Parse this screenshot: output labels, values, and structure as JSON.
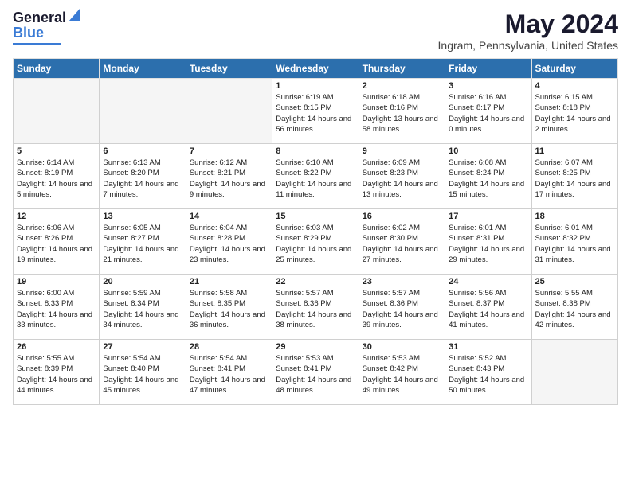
{
  "header": {
    "logo_text1": "General",
    "logo_text2": "Blue",
    "main_title": "May 2024",
    "subtitle": "Ingram, Pennsylvania, United States"
  },
  "weekdays": [
    "Sunday",
    "Monday",
    "Tuesday",
    "Wednesday",
    "Thursday",
    "Friday",
    "Saturday"
  ],
  "weeks": [
    [
      {
        "day": "",
        "sunrise": "",
        "sunset": "",
        "daylight": ""
      },
      {
        "day": "",
        "sunrise": "",
        "sunset": "",
        "daylight": ""
      },
      {
        "day": "",
        "sunrise": "",
        "sunset": "",
        "daylight": ""
      },
      {
        "day": "1",
        "sunrise": "Sunrise: 6:19 AM",
        "sunset": "Sunset: 8:15 PM",
        "daylight": "Daylight: 14 hours and 56 minutes."
      },
      {
        "day": "2",
        "sunrise": "Sunrise: 6:18 AM",
        "sunset": "Sunset: 8:16 PM",
        "daylight": "Daylight: 13 hours and 58 minutes."
      },
      {
        "day": "3",
        "sunrise": "Sunrise: 6:16 AM",
        "sunset": "Sunset: 8:17 PM",
        "daylight": "Daylight: 14 hours and 0 minutes."
      },
      {
        "day": "4",
        "sunrise": "Sunrise: 6:15 AM",
        "sunset": "Sunset: 8:18 PM",
        "daylight": "Daylight: 14 hours and 2 minutes."
      }
    ],
    [
      {
        "day": "5",
        "sunrise": "Sunrise: 6:14 AM",
        "sunset": "Sunset: 8:19 PM",
        "daylight": "Daylight: 14 hours and 5 minutes."
      },
      {
        "day": "6",
        "sunrise": "Sunrise: 6:13 AM",
        "sunset": "Sunset: 8:20 PM",
        "daylight": "Daylight: 14 hours and 7 minutes."
      },
      {
        "day": "7",
        "sunrise": "Sunrise: 6:12 AM",
        "sunset": "Sunset: 8:21 PM",
        "daylight": "Daylight: 14 hours and 9 minutes."
      },
      {
        "day": "8",
        "sunrise": "Sunrise: 6:10 AM",
        "sunset": "Sunset: 8:22 PM",
        "daylight": "Daylight: 14 hours and 11 minutes."
      },
      {
        "day": "9",
        "sunrise": "Sunrise: 6:09 AM",
        "sunset": "Sunset: 8:23 PM",
        "daylight": "Daylight: 14 hours and 13 minutes."
      },
      {
        "day": "10",
        "sunrise": "Sunrise: 6:08 AM",
        "sunset": "Sunset: 8:24 PM",
        "daylight": "Daylight: 14 hours and 15 minutes."
      },
      {
        "day": "11",
        "sunrise": "Sunrise: 6:07 AM",
        "sunset": "Sunset: 8:25 PM",
        "daylight": "Daylight: 14 hours and 17 minutes."
      }
    ],
    [
      {
        "day": "12",
        "sunrise": "Sunrise: 6:06 AM",
        "sunset": "Sunset: 8:26 PM",
        "daylight": "Daylight: 14 hours and 19 minutes."
      },
      {
        "day": "13",
        "sunrise": "Sunrise: 6:05 AM",
        "sunset": "Sunset: 8:27 PM",
        "daylight": "Daylight: 14 hours and 21 minutes."
      },
      {
        "day": "14",
        "sunrise": "Sunrise: 6:04 AM",
        "sunset": "Sunset: 8:28 PM",
        "daylight": "Daylight: 14 hours and 23 minutes."
      },
      {
        "day": "15",
        "sunrise": "Sunrise: 6:03 AM",
        "sunset": "Sunset: 8:29 PM",
        "daylight": "Daylight: 14 hours and 25 minutes."
      },
      {
        "day": "16",
        "sunrise": "Sunrise: 6:02 AM",
        "sunset": "Sunset: 8:30 PM",
        "daylight": "Daylight: 14 hours and 27 minutes."
      },
      {
        "day": "17",
        "sunrise": "Sunrise: 6:01 AM",
        "sunset": "Sunset: 8:31 PM",
        "daylight": "Daylight: 14 hours and 29 minutes."
      },
      {
        "day": "18",
        "sunrise": "Sunrise: 6:01 AM",
        "sunset": "Sunset: 8:32 PM",
        "daylight": "Daylight: 14 hours and 31 minutes."
      }
    ],
    [
      {
        "day": "19",
        "sunrise": "Sunrise: 6:00 AM",
        "sunset": "Sunset: 8:33 PM",
        "daylight": "Daylight: 14 hours and 33 minutes."
      },
      {
        "day": "20",
        "sunrise": "Sunrise: 5:59 AM",
        "sunset": "Sunset: 8:34 PM",
        "daylight": "Daylight: 14 hours and 34 minutes."
      },
      {
        "day": "21",
        "sunrise": "Sunrise: 5:58 AM",
        "sunset": "Sunset: 8:35 PM",
        "daylight": "Daylight: 14 hours and 36 minutes."
      },
      {
        "day": "22",
        "sunrise": "Sunrise: 5:57 AM",
        "sunset": "Sunset: 8:36 PM",
        "daylight": "Daylight: 14 hours and 38 minutes."
      },
      {
        "day": "23",
        "sunrise": "Sunrise: 5:57 AM",
        "sunset": "Sunset: 8:36 PM",
        "daylight": "Daylight: 14 hours and 39 minutes."
      },
      {
        "day": "24",
        "sunrise": "Sunrise: 5:56 AM",
        "sunset": "Sunset: 8:37 PM",
        "daylight": "Daylight: 14 hours and 41 minutes."
      },
      {
        "day": "25",
        "sunrise": "Sunrise: 5:55 AM",
        "sunset": "Sunset: 8:38 PM",
        "daylight": "Daylight: 14 hours and 42 minutes."
      }
    ],
    [
      {
        "day": "26",
        "sunrise": "Sunrise: 5:55 AM",
        "sunset": "Sunset: 8:39 PM",
        "daylight": "Daylight: 14 hours and 44 minutes."
      },
      {
        "day": "27",
        "sunrise": "Sunrise: 5:54 AM",
        "sunset": "Sunset: 8:40 PM",
        "daylight": "Daylight: 14 hours and 45 minutes."
      },
      {
        "day": "28",
        "sunrise": "Sunrise: 5:54 AM",
        "sunset": "Sunset: 8:41 PM",
        "daylight": "Daylight: 14 hours and 47 minutes."
      },
      {
        "day": "29",
        "sunrise": "Sunrise: 5:53 AM",
        "sunset": "Sunset: 8:41 PM",
        "daylight": "Daylight: 14 hours and 48 minutes."
      },
      {
        "day": "30",
        "sunrise": "Sunrise: 5:53 AM",
        "sunset": "Sunset: 8:42 PM",
        "daylight": "Daylight: 14 hours and 49 minutes."
      },
      {
        "day": "31",
        "sunrise": "Sunrise: 5:52 AM",
        "sunset": "Sunset: 8:43 PM",
        "daylight": "Daylight: 14 hours and 50 minutes."
      },
      {
        "day": "",
        "sunrise": "",
        "sunset": "",
        "daylight": ""
      }
    ]
  ]
}
